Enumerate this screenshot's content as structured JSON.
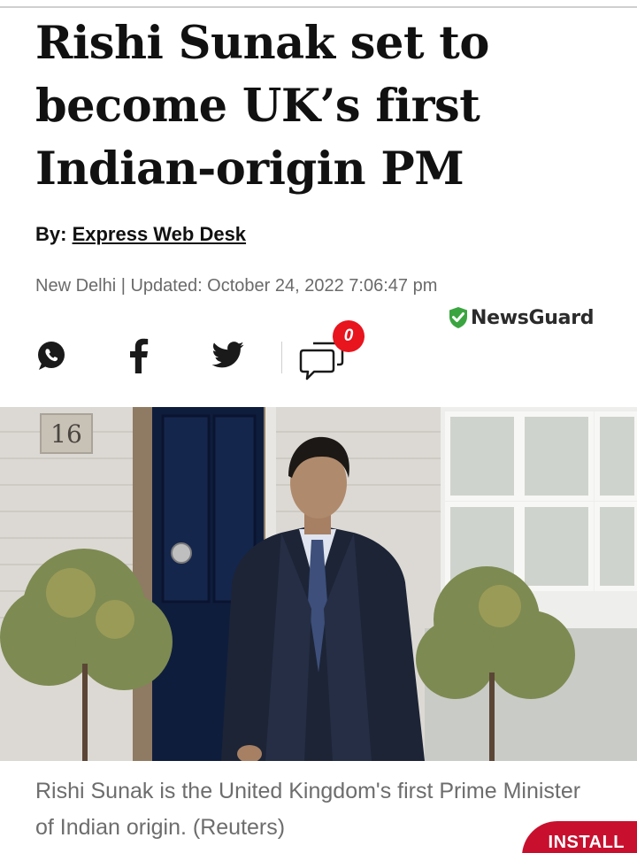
{
  "article": {
    "headline": "Rishi Sunak set to become UK’s first Indian-origin PM",
    "byline_prefix": "By: ",
    "author": "Express Web Desk",
    "dateline": "New Delhi | Updated: October 24, 2022 7:06:47 pm",
    "caption": "Rishi Sunak is the United Kingdom's first Prime Minister of Indian origin. (Reuters)"
  },
  "newsguard": {
    "label": "NewsGuard",
    "color": "#3aa540"
  },
  "share": {
    "icons": [
      "whatsapp-icon",
      "facebook-icon",
      "twitter-icon",
      "comments-icon"
    ],
    "comment_count": "0",
    "badge_color": "#e8141e"
  },
  "photo": {
    "house_number": "16"
  },
  "install": {
    "label": "INSTALL",
    "color": "#c8102e"
  }
}
